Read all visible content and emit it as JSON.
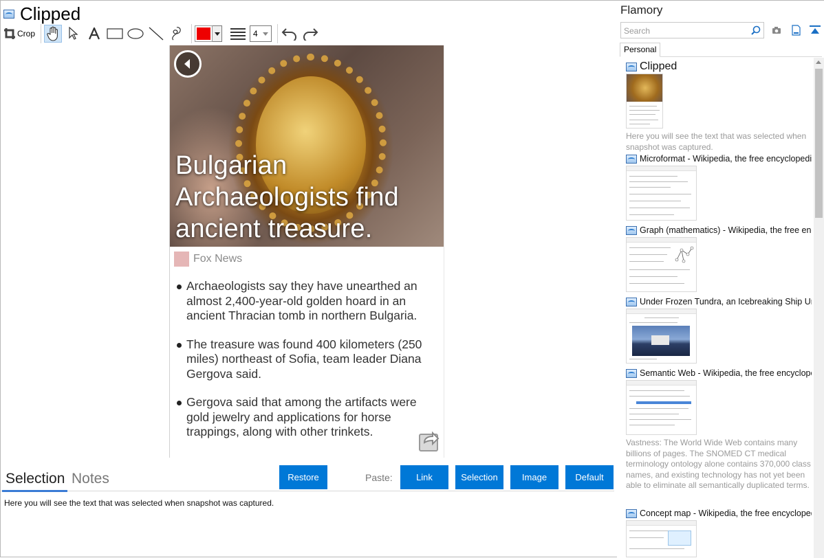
{
  "window": {
    "title": "Clipped"
  },
  "toolbar": {
    "crop_label": "Crop",
    "color": "#ee0000",
    "line_width": "4"
  },
  "snapshot": {
    "headline": "Bulgarian Archaeologists find ancient treasure.",
    "source": "Fox News",
    "bullets": [
      "Archaeologists say they have unearthed an almost 2,400-year-old golden hoard in an ancient Thracian tomb in northern Bulgaria.",
      "The treasure was found 400 kilometers (250 miles) northeast of Sofia, team leader Diana Gergova said.",
      "Gergova said that among the artifacts were gold jewelry and applications for horse trappings, along with other trinkets."
    ]
  },
  "bottom": {
    "tabs": [
      "Selection",
      "Notes"
    ],
    "restore_label": "Restore",
    "paste_label": "Paste:",
    "paste_buttons": [
      "Link",
      "Selection",
      "Image",
      "Default"
    ],
    "selection_text": "Here you will see the text that was selected when snapshot was captured."
  },
  "sidebar": {
    "title": "Flamory",
    "search_placeholder": "Search",
    "tab": "Personal",
    "entries": [
      {
        "title": "Clipped",
        "desc": "Here you will see the text that was selected when snapshot was captured."
      },
      {
        "title": "Microformat - Wikipedia, the free encyclopedia",
        "desc": ""
      },
      {
        "title": "Graph (mathematics) - Wikipedia, the free encyclopedia",
        "desc": ""
      },
      {
        "title": "Under Frozen Tundra, an Icebreaking Ship Uncovers",
        "desc": ""
      },
      {
        "title": "Semantic Web - Wikipedia, the free encyclopedia",
        "desc": "Vastness: The World Wide Web contains many billions of pages. The SNOMED CT medical terminology ontology alone contains 370,000 class names, and existing technology has not yet been able to eliminate all semantically duplicated terms. Any automated reasoning system will have to deal with truly huge inputs."
      },
      {
        "title": "Concept map - Wikipedia, the free encyclopedia",
        "desc": ""
      }
    ]
  },
  "colors": {
    "accent": "#0078d7",
    "tab_underline": "#3a7bd5",
    "muted": "#9a9a9a"
  }
}
